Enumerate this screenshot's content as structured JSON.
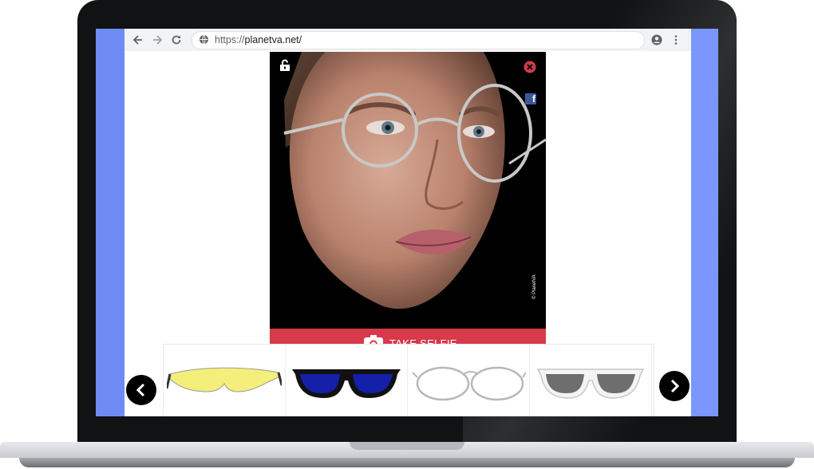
{
  "browser": {
    "back_icon": "arrow-left-icon",
    "forward_icon": "arrow-right-icon",
    "reload_icon": "reload-icon",
    "url_scheme": "https://",
    "url_host": "planetva.net/",
    "account_icon": "account-circle-icon",
    "menu_icon": "kebab-menu-icon"
  },
  "viewer": {
    "lock_icon": "unlock-icon",
    "close_icon": "close-circle-icon",
    "share_icon": "facebook-icon",
    "copyright": "© PlanetVA",
    "selfie_button": "TAKE SELFIE",
    "selfie_icon": "camera-icon"
  },
  "carousel": {
    "prev_icon": "chevron-left-icon",
    "next_icon": "chevron-right-icon",
    "items": [
      {
        "name": "yellow-safety-glasses",
        "lens_color": "#f4ef7a"
      },
      {
        "name": "blue-sunglasses",
        "lens_color": "#1420a8"
      },
      {
        "name": "round-metal-frames",
        "lens_color": "#ffffff"
      },
      {
        "name": "white-mirror-sunglasses",
        "lens_color": "#6e6e6e"
      }
    ]
  },
  "colors": {
    "accent": "#d63a4b",
    "screen_bg": "#6f8cf5",
    "facebook": "#3b5998"
  }
}
